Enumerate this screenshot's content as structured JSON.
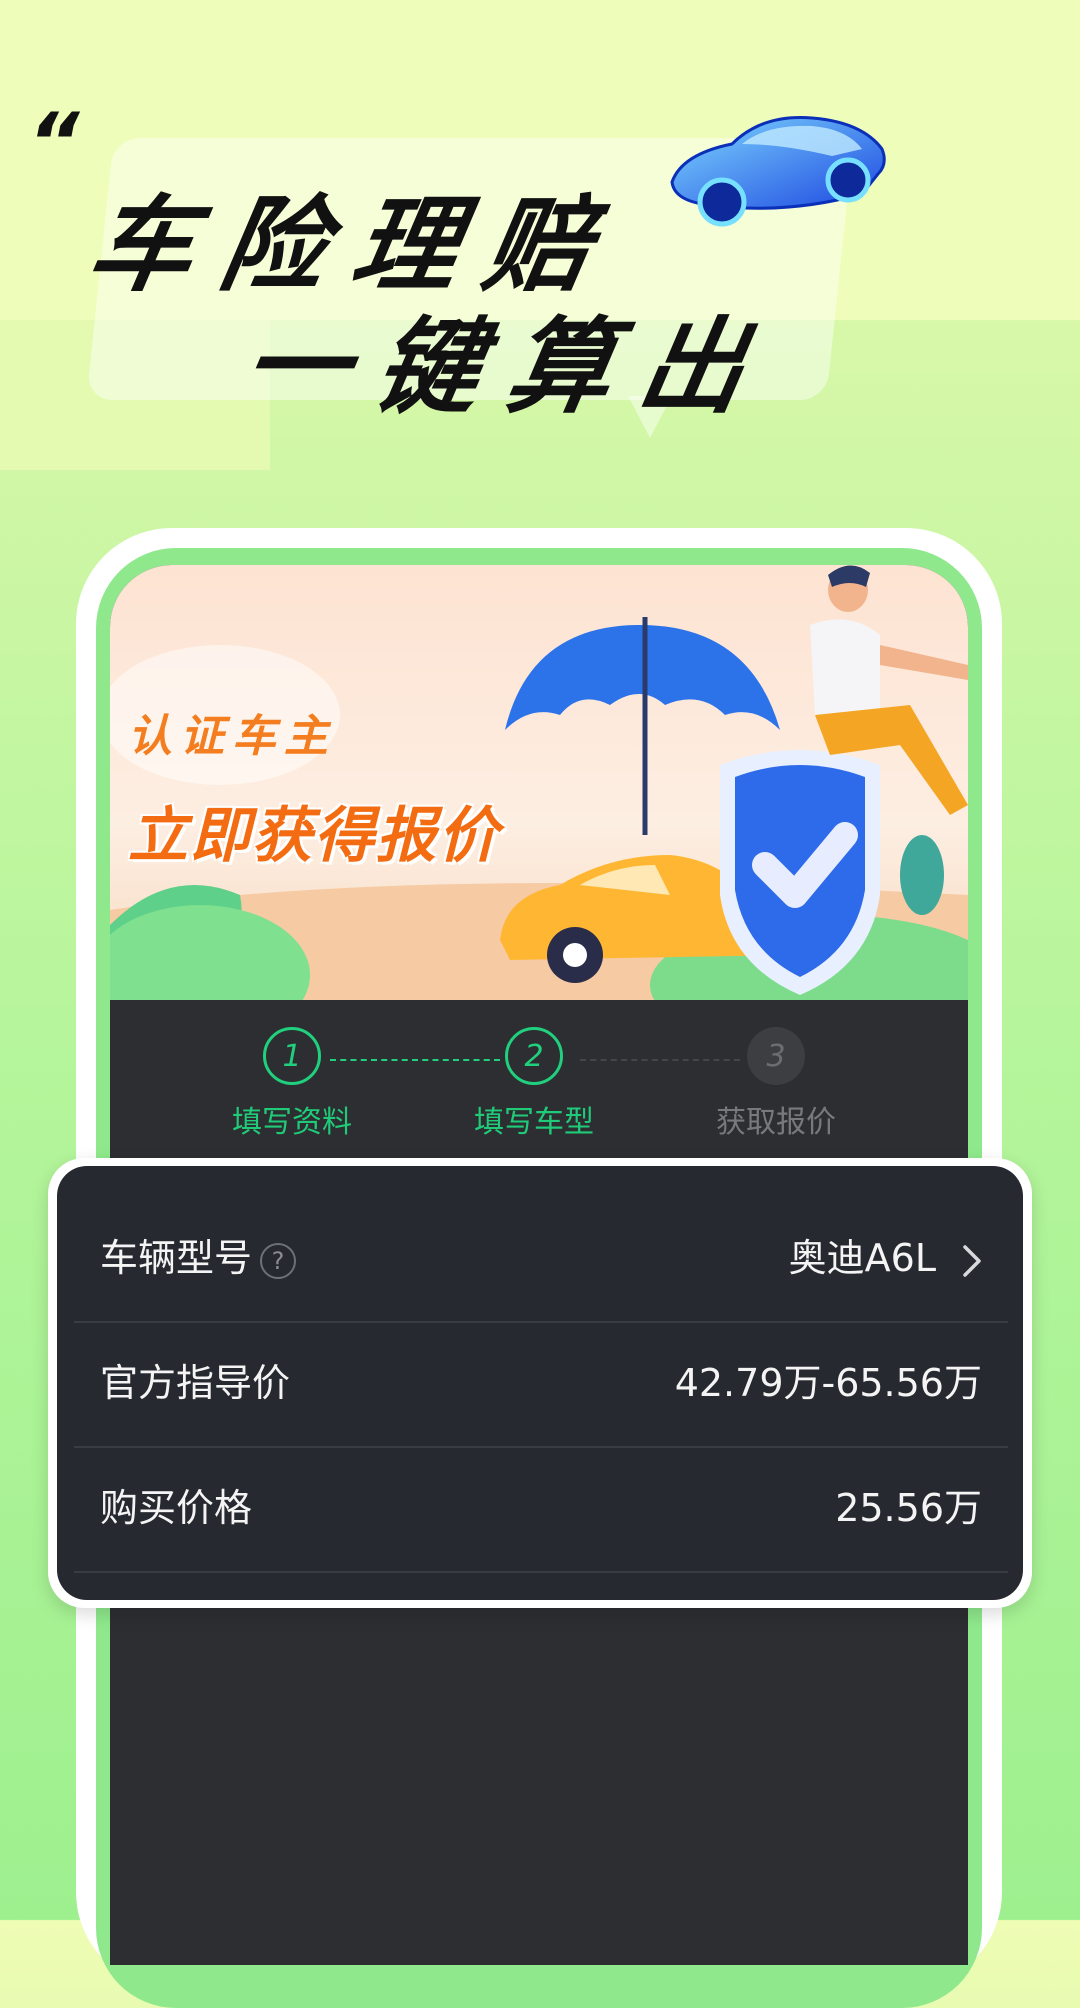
{
  "hero": {
    "quote_mark": "“",
    "line1": "车险理赔",
    "line2": "一键算出"
  },
  "banner": {
    "subtitle": "认证车主",
    "title": "立即获得报价"
  },
  "steps": [
    {
      "number": "1",
      "label": "填写资料",
      "state": "done"
    },
    {
      "number": "2",
      "label": "填写车型",
      "state": "done"
    },
    {
      "number": "3",
      "label": "获取报价",
      "state": "todo"
    }
  ],
  "vehicle_info": {
    "model_label": "车辆型号",
    "help_symbol": "?",
    "model_value": "奥迪A6L",
    "guide_price_label": "官方指导价",
    "guide_price_value": "42.79万-65.56万",
    "purchase_price_label": "购买价格",
    "purchase_price_value": "25.56万"
  },
  "colors": {
    "accent_green": "#20d07e",
    "banner_orange": "#f46c12",
    "card_bg": "#272930",
    "screen_bg": "#2d2e31"
  },
  "icons": [
    "car-3d-icon",
    "umbrella-icon",
    "shield-check-icon",
    "chevron-right-icon",
    "help-icon"
  ]
}
